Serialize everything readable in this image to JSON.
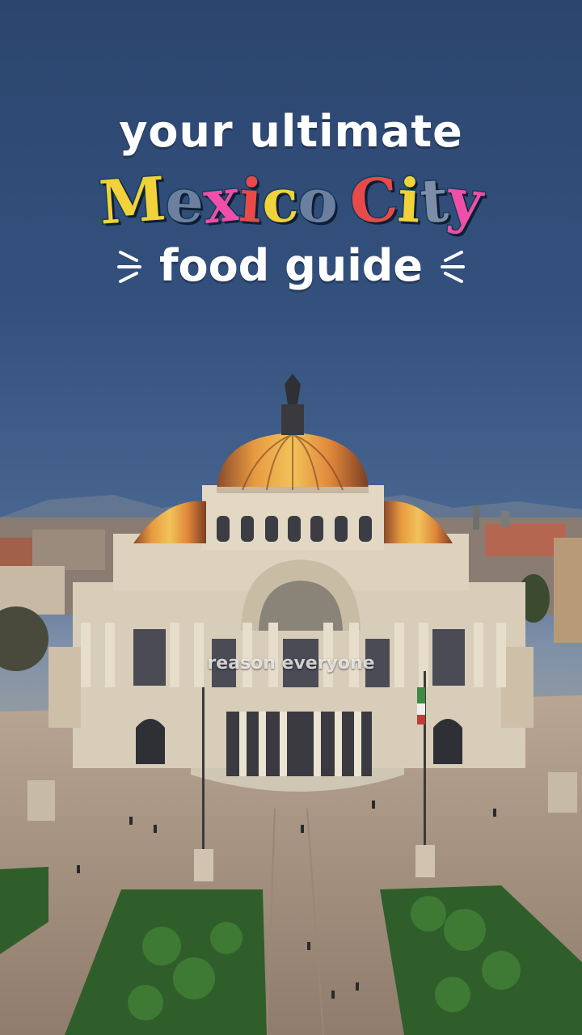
{
  "title": {
    "line1": "your ultimate",
    "line2_letters": [
      {
        "ch": "M",
        "color": "#f2d23a"
      },
      {
        "ch": "e",
        "color": "#6d7fa1"
      },
      {
        "ch": "x",
        "color": "#ee4fa8"
      },
      {
        "ch": "i",
        "color": "#e84a4a"
      },
      {
        "ch": "c",
        "color": "#f2d23a"
      },
      {
        "ch": "o",
        "color": "#6d7fa1"
      },
      {
        "ch": " ",
        "color": "#ffffff"
      },
      {
        "ch": "C",
        "color": "#e84a4a"
      },
      {
        "ch": "i",
        "color": "#f2d23a"
      },
      {
        "ch": "t",
        "color": "#7f8ea8"
      },
      {
        "ch": "y",
        "color": "#ee4fa8"
      }
    ],
    "line3": "food guide"
  },
  "caption": "reason everyone",
  "colors": {
    "sky_top": "#2b456e",
    "dome": "#d9823a",
    "marble": "#d8cdb8",
    "plaza": "#a89684",
    "garden": "#2f5e2a"
  }
}
